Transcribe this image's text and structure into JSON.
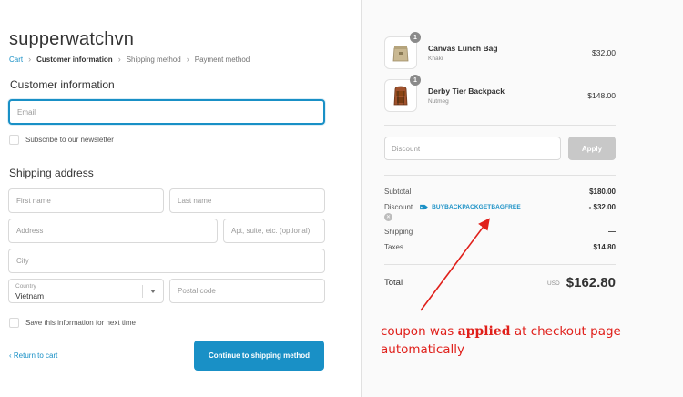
{
  "store": {
    "title": "supperwatchvn"
  },
  "breadcrumb": {
    "items": [
      {
        "label": "Cart"
      },
      {
        "label": "Customer information"
      },
      {
        "label": "Shipping method"
      },
      {
        "label": "Payment method"
      }
    ],
    "separator": "›"
  },
  "customer": {
    "title": "Customer information",
    "email_placeholder": "Email",
    "newsletter_label": "Subscribe to our newsletter"
  },
  "shipping": {
    "title": "Shipping address",
    "first_name_placeholder": "First name",
    "last_name_placeholder": "Last name",
    "address_placeholder": "Address",
    "apt_placeholder": "Apt, suite, etc. (optional)",
    "city_placeholder": "City",
    "country_label": "Country",
    "country_value": "Vietnam",
    "postal_placeholder": "Postal code",
    "save_label": "Save this information for next time"
  },
  "actions": {
    "return_label": "Return to cart",
    "return_icon": "chevron-left-icon",
    "continue_label": "Continue to shipping method"
  },
  "order": {
    "products": [
      {
        "name": "Canvas Lunch Bag",
        "variant": "Khaki",
        "price": "$32.00",
        "quantity": "1",
        "icon": "lunch-bag-icon"
      },
      {
        "name": "Derby Tier Backpack",
        "variant": "Nutmeg",
        "price": "$148.00",
        "quantity": "1",
        "icon": "backpack-icon"
      }
    ],
    "discount_placeholder": "Discount",
    "apply_label": "Apply",
    "subtotal_label": "Subtotal",
    "subtotal_value": "$180.00",
    "discount_label": "Discount",
    "discount_code": "BUYBACKPACKGETBAGFREE",
    "discount_value": "- $32.00",
    "shipping_label": "Shipping",
    "shipping_value": "—",
    "taxes_label": "Taxes",
    "taxes_value": "$14.80",
    "total_label": "Total",
    "currency": "USD",
    "total_value": "$162.80"
  },
  "annotation": {
    "part1": "coupon was ",
    "bold": "applied",
    "part2": " at checkout page automatically",
    "color": "#e0201b"
  },
  "colors": {
    "accent": "#1990c6",
    "annotation_red": "#e0201b"
  }
}
